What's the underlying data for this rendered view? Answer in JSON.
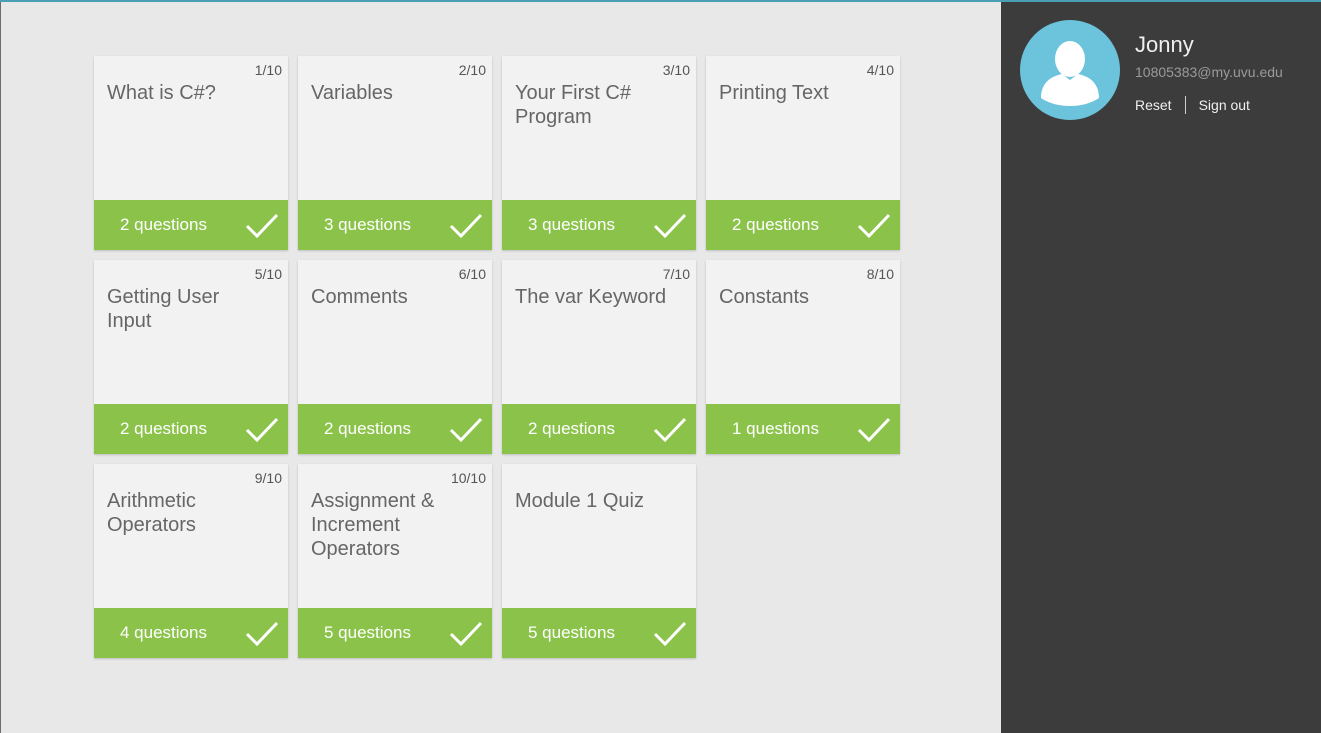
{
  "user": {
    "name": "Jonny",
    "email": "10805383@my.uvu.edu",
    "reset_label": "Reset",
    "signout_label": "Sign out"
  },
  "colors": {
    "accent_green": "#8bc34a",
    "avatar_blue": "#6cc3dc",
    "sidebar_bg": "#3c3c3c"
  },
  "lessons": [
    {
      "number": "1/10",
      "title": "What is C#?",
      "questions": "2 questions",
      "completed": true
    },
    {
      "number": "2/10",
      "title": "Variables",
      "questions": "3 questions",
      "completed": true
    },
    {
      "number": "3/10",
      "title": "Your First C# Program",
      "questions": "3 questions",
      "completed": true
    },
    {
      "number": "4/10",
      "title": "Printing Text",
      "questions": "2 questions",
      "completed": true
    },
    {
      "number": "5/10",
      "title": "Getting User Input",
      "questions": "2 questions",
      "completed": true
    },
    {
      "number": "6/10",
      "title": "Comments",
      "questions": "2 questions",
      "completed": true
    },
    {
      "number": "7/10",
      "title": "The var Keyword",
      "questions": "2 questions",
      "completed": true
    },
    {
      "number": "8/10",
      "title": "Constants",
      "questions": "1 questions",
      "completed": true
    },
    {
      "number": "9/10",
      "title": "Arithmetic Operators",
      "questions": "4 questions",
      "completed": true
    },
    {
      "number": "10/10",
      "title": "Assignment & Increment Operators",
      "questions": "5 questions",
      "completed": true
    },
    {
      "number": "",
      "title": "Module 1 Quiz",
      "questions": "5 questions",
      "completed": true
    }
  ]
}
